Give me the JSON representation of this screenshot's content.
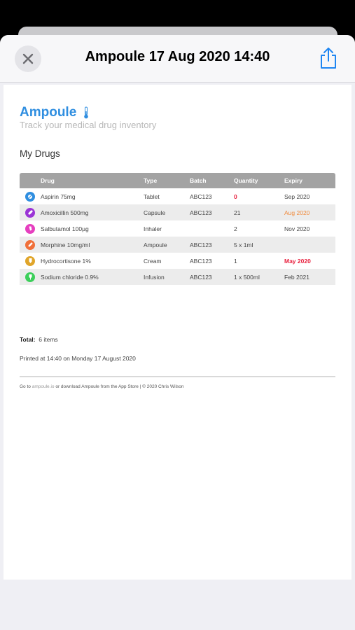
{
  "header": {
    "title": "Ampoule 17 Aug 2020 14:40"
  },
  "brand": {
    "name": "Ampoule",
    "tagline": "Track your medical drug inventory"
  },
  "section_title": "My Drugs",
  "table": {
    "headers": {
      "drug": "Drug",
      "type": "Type",
      "batch": "Batch",
      "quantity": "Quantity",
      "expiry": "Expiry"
    },
    "rows": [
      {
        "icon": "tablet-icon",
        "color": "#2f8ee0",
        "drug": "Aspirin 75mg",
        "type": "Tablet",
        "batch": "ABC123",
        "quantity": "0",
        "expiry": "Sep 2020"
      },
      {
        "icon": "capsule-icon",
        "color": "#9b35d6",
        "drug": "Amoxicillin 500mg",
        "type": "Capsule",
        "batch": "ABC123",
        "quantity": "21",
        "expiry": "Aug 2020"
      },
      {
        "icon": "inhaler-icon",
        "color": "#e63fbf",
        "drug": "Salbutamol 100µg",
        "type": "Inhaler",
        "batch": "",
        "quantity": "2",
        "expiry": "Nov 2020"
      },
      {
        "icon": "ampoule-icon",
        "color": "#f0703a",
        "drug": "Morphine 10mg/ml",
        "type": "Ampoule",
        "batch": "ABC123",
        "quantity": "5 x 1ml",
        "expiry": ""
      },
      {
        "icon": "cream-icon",
        "color": "#e0a52a",
        "drug": "Hydrocortisone 1%",
        "type": "Cream",
        "batch": "ABC123",
        "quantity": "1",
        "expiry": "May 2020"
      },
      {
        "icon": "infusion-icon",
        "color": "#3ccf5a",
        "drug": "Sodium chloride 0.9%",
        "type": "Infusion",
        "batch": "ABC123",
        "quantity": "1 x 500ml",
        "expiry": "Feb 2021"
      }
    ]
  },
  "total": {
    "label": "Total:",
    "value": "6 items"
  },
  "printed": "Printed at 14:40 on Monday 17 August 2020",
  "footer": {
    "prefix": "Go to ",
    "link": "ampoule.io",
    "suffix": " or download Ampoule from the App Store | © 2020 Chris Wilson"
  },
  "colors": {
    "accent": "#2f8ee0",
    "warning": "#f08a3c",
    "danger": "#e8203e"
  }
}
